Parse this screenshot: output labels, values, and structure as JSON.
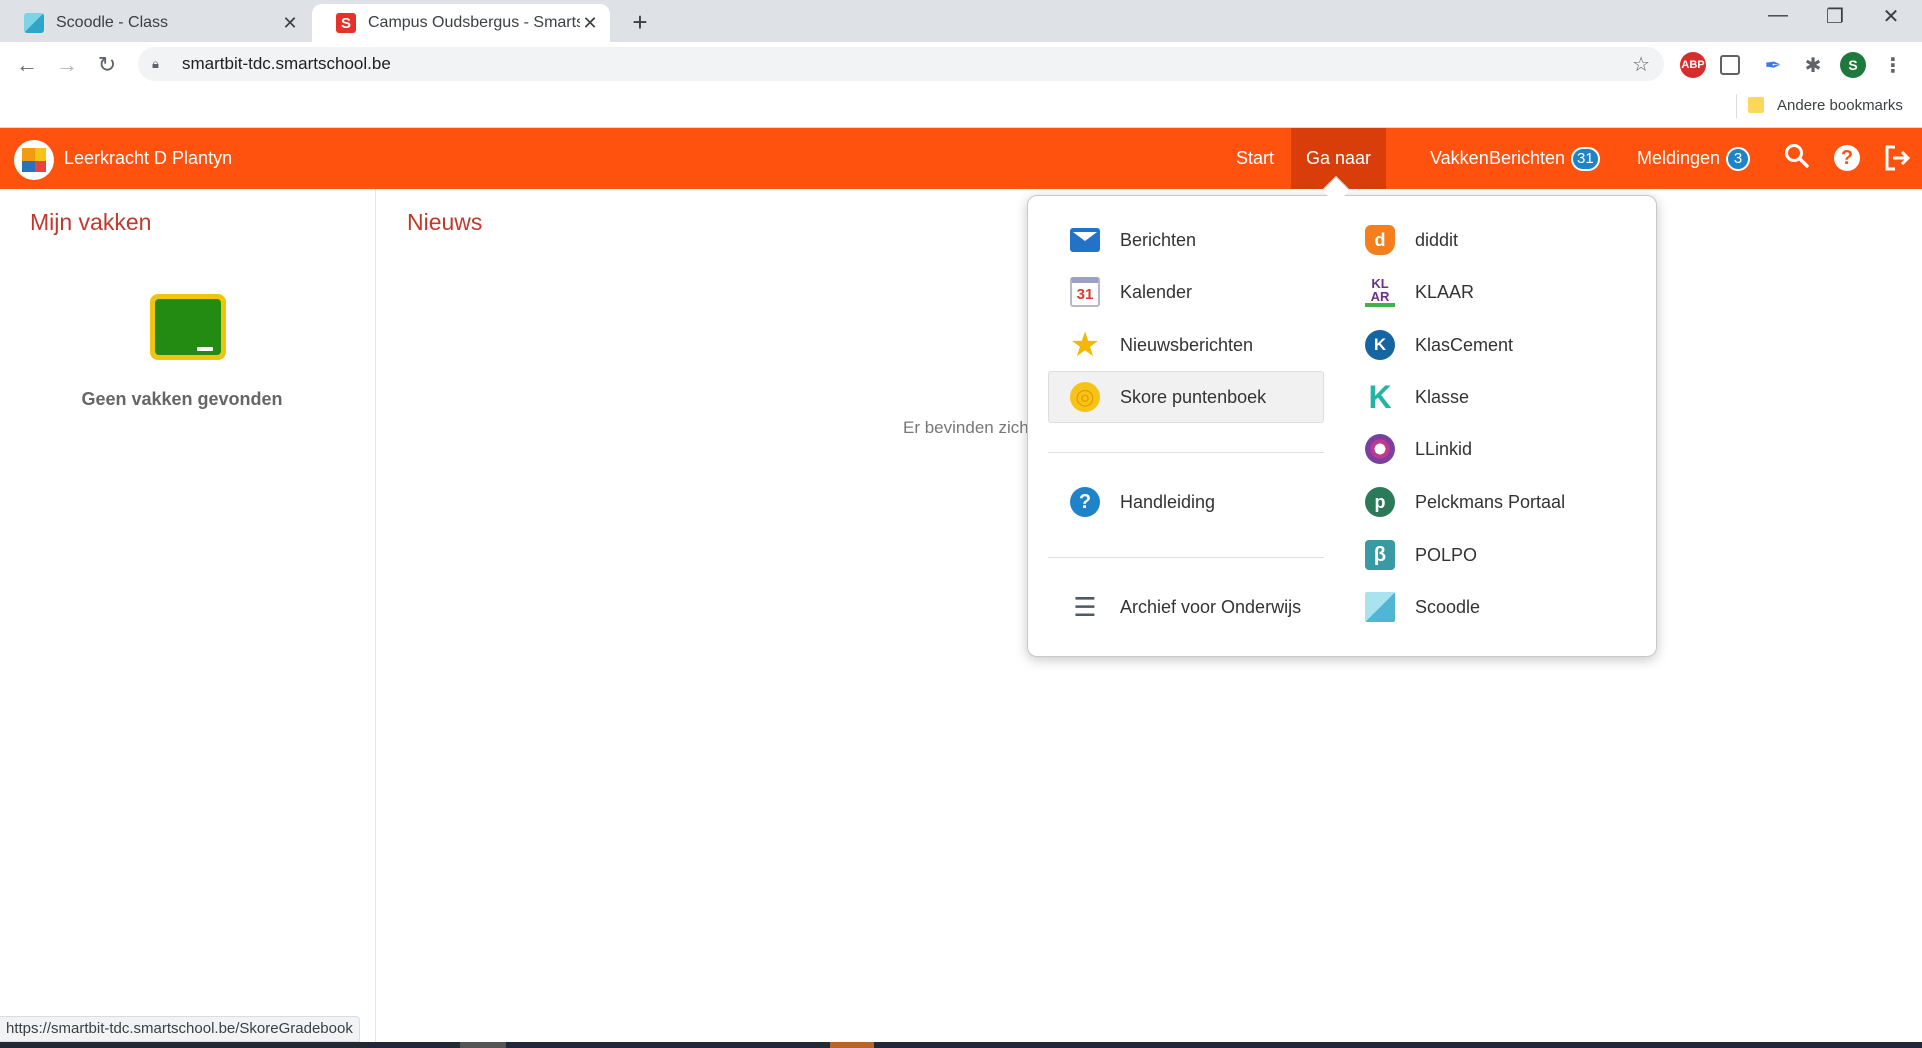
{
  "browser": {
    "tabs": [
      {
        "title": "Scoodle - Class",
        "active": false
      },
      {
        "title": "Campus Oudsbergus - Smartsch",
        "active": true
      }
    ],
    "new_tab": "+",
    "window_controls": {
      "minimize": "—",
      "restore": "❐",
      "close": "✕"
    },
    "url": "smartbit-tdc.smartschool.be",
    "bookmarks_folder": "Andere bookmarks",
    "extensions": [
      "ABP"
    ],
    "profile_initial": "S",
    "status_url": "https://smartbit-tdc.smartschool.be/SkoreGradebook"
  },
  "header": {
    "user": "Leerkracht D Plantyn",
    "nav": [
      {
        "label": "Start"
      },
      {
        "label": "Ga naar"
      },
      {
        "label": "Vakken"
      },
      {
        "label": "Berichten",
        "badge": "31"
      },
      {
        "label": "Meldingen",
        "badge": "3"
      }
    ],
    "accent_color": "#ff520e"
  },
  "left_pane": {
    "title": "Mijn vakken",
    "empty_message": "Geen vakken gevonden"
  },
  "news": {
    "title": "Nieuws",
    "empty_message": "Er bevinden zich"
  },
  "menu": {
    "left": [
      {
        "label": "Berichten",
        "icon": "mail-icon"
      },
      {
        "label": "Kalender",
        "icon": "calendar-icon",
        "icon_text": "31"
      },
      {
        "label": "Nieuwsberichten",
        "icon": "star-icon"
      },
      {
        "label": "Skore puntenboek",
        "icon": "skore-icon"
      },
      {
        "label": "Handleiding",
        "icon": "help-icon"
      },
      {
        "label": "Archief voor Onderwijs",
        "icon": "archive-icon"
      }
    ],
    "right": [
      {
        "label": "diddit",
        "icon": "diddit-icon"
      },
      {
        "label": "KLAAR",
        "icon": "klaar-icon"
      },
      {
        "label": "KlasCement",
        "icon": "klascement-icon"
      },
      {
        "label": "Klasse",
        "icon": "klasse-icon"
      },
      {
        "label": "LLinkid",
        "icon": "llinkid-icon"
      },
      {
        "label": "Pelckmans Portaal",
        "icon": "pelckmans-icon"
      },
      {
        "label": "POLPO",
        "icon": "polpo-icon"
      },
      {
        "label": "Scoodle",
        "icon": "scoodle-icon"
      }
    ]
  }
}
